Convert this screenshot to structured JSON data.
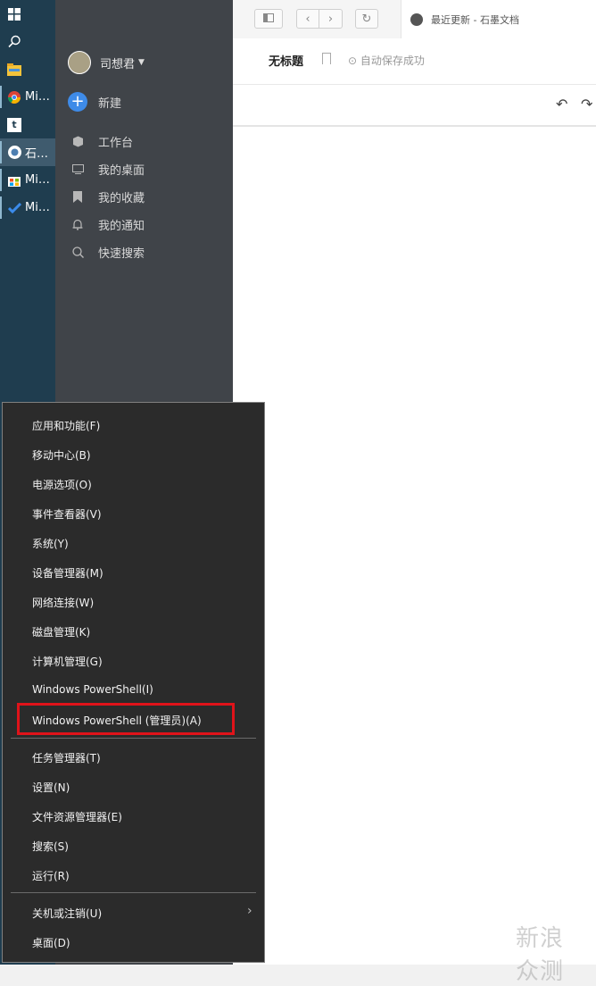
{
  "taskbar": {
    "items": [
      {
        "icon": "windows-start-icon",
        "label": ""
      },
      {
        "icon": "search-icon",
        "label": ""
      },
      {
        "icon": "file-explorer-icon",
        "label": ""
      },
      {
        "icon": "chrome-icon",
        "label": "Mi…"
      },
      {
        "icon": "tumblr-icon",
        "label": ""
      },
      {
        "icon": "shimo-icon",
        "label": "石…"
      },
      {
        "icon": "store-icon",
        "label": "Mi…"
      },
      {
        "icon": "todo-icon",
        "label": "Mi…"
      }
    ]
  },
  "sidebar": {
    "user_name": "司想君",
    "new_label": "新建",
    "items": [
      {
        "icon": "workbench-icon",
        "label": "工作台"
      },
      {
        "icon": "desktop-icon",
        "label": "我的桌面"
      },
      {
        "icon": "bookmark-icon",
        "label": "我的收藏"
      },
      {
        "icon": "bell-icon",
        "label": "我的通知"
      },
      {
        "icon": "search-icon",
        "label": "快速搜索"
      }
    ]
  },
  "browser": {
    "tab_title": "最近更新 - 石墨文档"
  },
  "document": {
    "title": "无标题",
    "save_status": "自动保存成功"
  },
  "context_menu": {
    "items": [
      "应用和功能(F)",
      "移动中心(B)",
      "电源选项(O)",
      "事件查看器(V)",
      "系统(Y)",
      "设备管理器(M)",
      "网络连接(W)",
      "磁盘管理(K)",
      "计算机管理(G)",
      "Windows PowerShell(I)",
      "Windows PowerShell (管理员)(A)",
      "任务管理器(T)",
      "设置(N)",
      "文件资源管理器(E)",
      "搜索(S)",
      "运行(R)",
      "关机或注销(U)",
      "桌面(D)"
    ],
    "highlight_color": "#e0131a"
  },
  "watermark": "新浪 众测"
}
